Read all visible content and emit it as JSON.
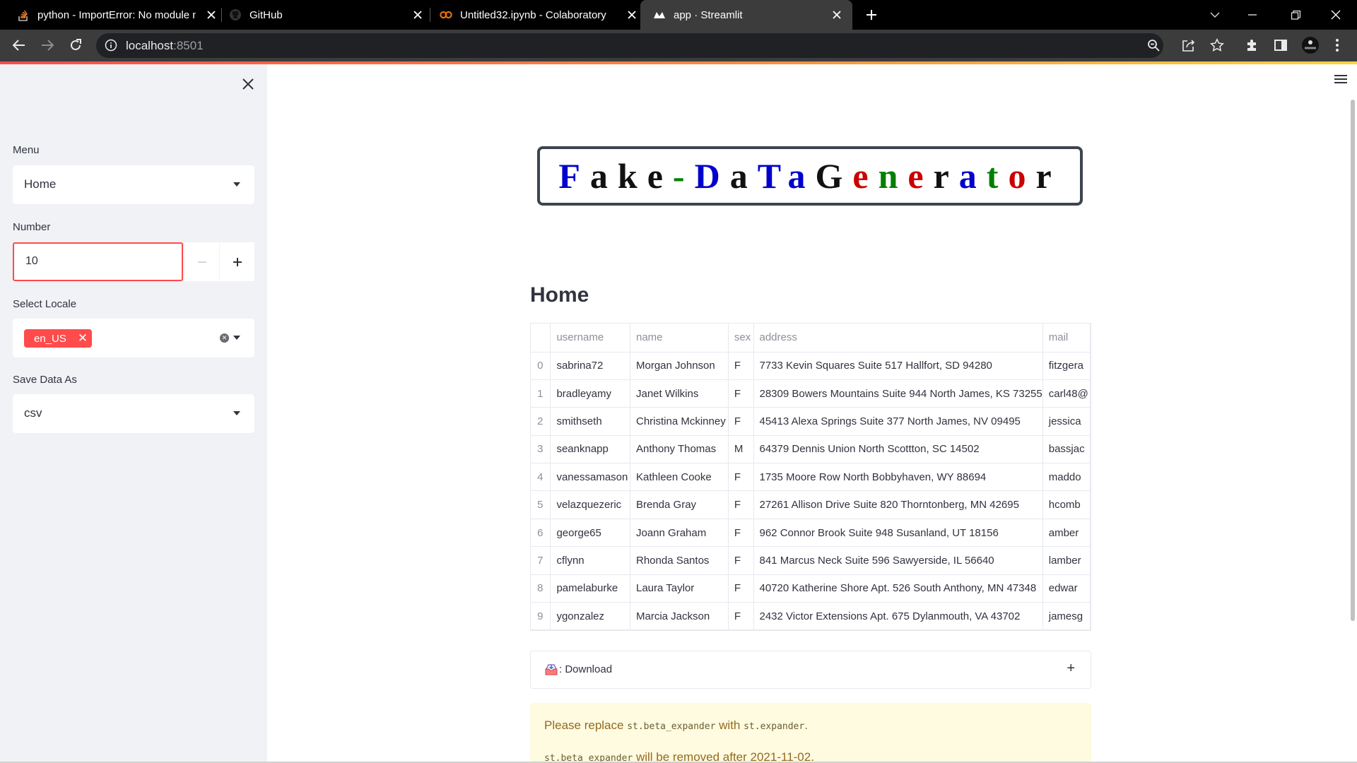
{
  "browser": {
    "tabs": [
      {
        "title": "python - ImportError: No module named",
        "icon": "stackoverflow-icon"
      },
      {
        "title": "GitHub",
        "icon": "github-icon"
      },
      {
        "title": "Untitled32.ipynb - Colaboratory",
        "icon": "colab-icon"
      },
      {
        "title": "app · Streamlit",
        "icon": "streamlit-icon"
      }
    ],
    "address": {
      "host": "localhost",
      "port": ":8501"
    }
  },
  "sidebar": {
    "menu_label": "Menu",
    "menu_value": "Home",
    "number_label": "Number",
    "number_value": "10",
    "locale_label": "Select Locale",
    "locale_tag": "en_US",
    "save_label": "Save Data As",
    "save_value": "csv"
  },
  "banner": {
    "letters": [
      {
        "ch": "F",
        "color": "#0000cc"
      },
      {
        "ch": "a",
        "color": "#111111"
      },
      {
        "ch": "k",
        "color": "#111111"
      },
      {
        "ch": "e",
        "color": "#111111"
      },
      {
        "ch": "-",
        "color": "#008000"
      },
      {
        "ch": "D",
        "color": "#0000cc"
      },
      {
        "ch": "a",
        "color": "#111111"
      },
      {
        "ch": "T",
        "color": "#0000cc"
      },
      {
        "ch": "a",
        "color": "#0000cc"
      },
      {
        "ch": "G",
        "color": "#111111"
      },
      {
        "ch": "e",
        "color": "#cc0000"
      },
      {
        "ch": "n",
        "color": "#008000"
      },
      {
        "ch": "e",
        "color": "#cc0000"
      },
      {
        "ch": "r",
        "color": "#111111"
      },
      {
        "ch": "a",
        "color": "#0000cc"
      },
      {
        "ch": "t",
        "color": "#008000"
      },
      {
        "ch": "o",
        "color": "#cc0000"
      },
      {
        "ch": "r",
        "color": "#111111"
      }
    ]
  },
  "main": {
    "heading": "Home",
    "table": {
      "columns": [
        "",
        "username",
        "name",
        "sex",
        "address",
        "mail"
      ],
      "rows": [
        [
          "0",
          "sabrina72",
          "Morgan Johnson",
          "F",
          "7733 Kevin Squares Suite 517 Hallfort, SD 94280",
          "fitzgera"
        ],
        [
          "1",
          "bradleyamy",
          "Janet Wilkins",
          "F",
          "28309 Bowers Mountains Suite 944 North James, KS 73255",
          "carl48@"
        ],
        [
          "2",
          "smithseth",
          "Christina Mckinney",
          "F",
          "45413 Alexa Springs Suite 377 North James, NV 09495",
          "jessica"
        ],
        [
          "3",
          "seanknapp",
          "Anthony Thomas",
          "M",
          "64379 Dennis Union North Scottton, SC 14502",
          "bassjac"
        ],
        [
          "4",
          "vanessamason",
          "Kathleen Cooke",
          "F",
          "1735 Moore Row North Bobbyhaven, WY 88694",
          "maddo"
        ],
        [
          "5",
          "velazquezeric",
          "Brenda Gray",
          "F",
          "27261 Allison Drive Suite 820 Thorntonberg, MN 42695",
          "hcomb"
        ],
        [
          "6",
          "george65",
          "Joann Graham",
          "F",
          "962 Connor Brook Suite 948 Susanland, UT 18156",
          "amber"
        ],
        [
          "7",
          "cflynn",
          "Rhonda Santos",
          "F",
          "841 Marcus Neck Suite 596 Sawyerside, IL 56640",
          "lamber"
        ],
        [
          "8",
          "pamelaburke",
          "Laura Taylor",
          "F",
          "40720 Katherine Shore Apt. 526 South Anthony, MN 47348",
          "edwar"
        ],
        [
          "9",
          "ygonzalez",
          "Marcia Jackson",
          "F",
          "2432 Victor Extensions Apt. 675 Dylanmouth, VA 43702",
          "jamesg"
        ]
      ]
    },
    "expander_label": ": Download",
    "warning": {
      "line1_a": "Please replace ",
      "line1_code1": "st.beta_expander",
      "line1_b": " with ",
      "line1_code2": "st.expander",
      "line1_c": ".",
      "line2_code": "st.beta_expander",
      "line2_a": " will be removed after 2021-11-02."
    }
  }
}
